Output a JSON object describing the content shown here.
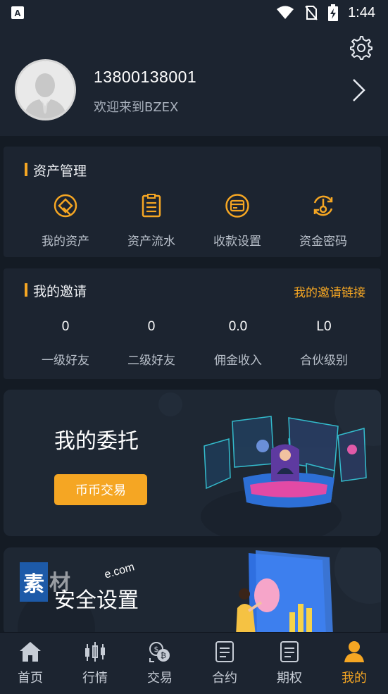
{
  "status_bar": {
    "time": "1:44",
    "app_icon_letter": "A"
  },
  "profile": {
    "phone": "13800138001",
    "welcome": "欢迎来到BZEX"
  },
  "asset_management": {
    "title": "资产管理",
    "items": [
      {
        "label": "我的资产",
        "icon": "assets-icon"
      },
      {
        "label": "资产流水",
        "icon": "ledger-icon"
      },
      {
        "label": "收款设置",
        "icon": "card-icon"
      },
      {
        "label": "资金密码",
        "icon": "key-lock-icon"
      }
    ]
  },
  "invitation": {
    "title": "我的邀请",
    "link_label": "我的邀请链接",
    "stats": [
      {
        "value": "0",
        "label": "一级好友"
      },
      {
        "value": "0",
        "label": "二级好友"
      },
      {
        "value": "0.0",
        "label": "佣金收入"
      },
      {
        "value": "L0",
        "label": "合伙级别"
      }
    ]
  },
  "banner_orders": {
    "title": "我的委托",
    "button": "币币交易"
  },
  "banner_security": {
    "title": "安全设置"
  },
  "watermark": {
    "logo": "素",
    "text": "材",
    "url": "e.com"
  },
  "bottom_nav": [
    {
      "label": "首页",
      "icon": "home-icon"
    },
    {
      "label": "行情",
      "icon": "candlestick-icon"
    },
    {
      "label": "交易",
      "icon": "bitcoin-exchange-icon"
    },
    {
      "label": "合约",
      "icon": "contract-icon"
    },
    {
      "label": "期权",
      "icon": "option-icon"
    },
    {
      "label": "我的",
      "icon": "user-icon",
      "active": true
    }
  ],
  "colors": {
    "accent": "#f5a623",
    "background": "#141b24",
    "card": "#1c2430"
  }
}
